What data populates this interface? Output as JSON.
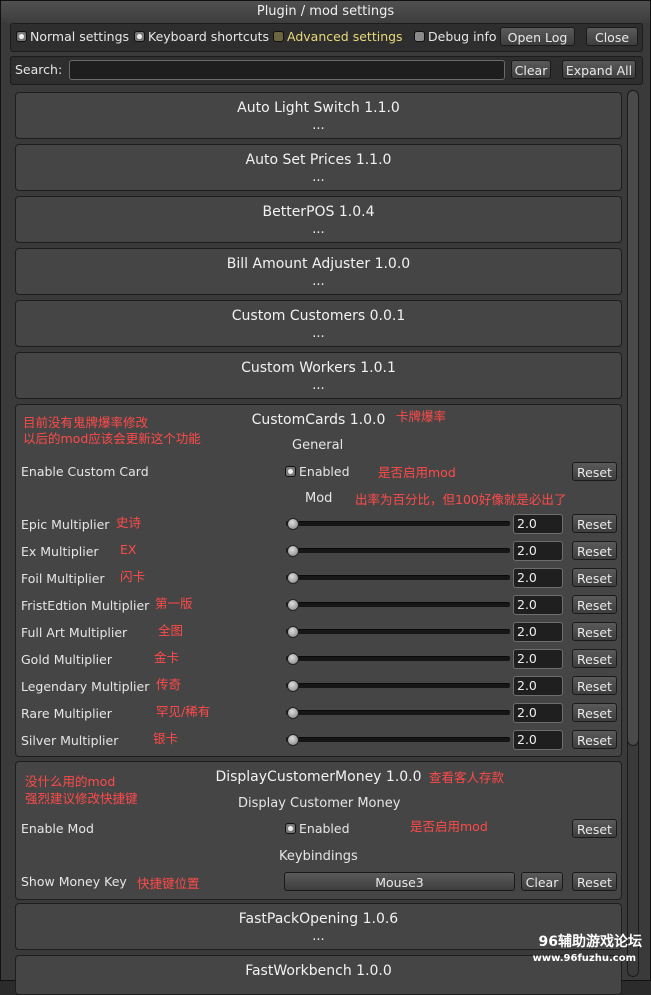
{
  "window": {
    "title": "Plugin / mod settings"
  },
  "toolbar": {
    "normal": "Normal settings",
    "keyboard": "Keyboard shortcuts",
    "advanced": "Advanced settings",
    "debug": "Debug info",
    "open_log": "Open Log",
    "close": "Close"
  },
  "search": {
    "label": "Search:",
    "value": "",
    "clear": "Clear",
    "expand": "Expand All"
  },
  "collapsed": [
    {
      "title": "Auto Light Switch 1.1.0",
      "dots": "..."
    },
    {
      "title": "Auto Set Prices 1.1.0",
      "dots": "..."
    },
    {
      "title": "BetterPOS 1.0.4",
      "dots": "..."
    },
    {
      "title": "Bill Amount Adjuster 1.0.0",
      "dots": "..."
    },
    {
      "title": "Custom Customers 0.0.1",
      "dots": "..."
    },
    {
      "title": "Custom Workers 1.0.1",
      "dots": "..."
    }
  ],
  "customcards": {
    "title": "CustomCards 1.0.0",
    "note_title": "卡牌爆率",
    "note_left_1": "目前没有鬼牌爆率修改",
    "note_left_2": "以后的mod应该会更新这个功能",
    "general": "General",
    "enable_label": "Enable Custom Card",
    "enabled": "Enabled",
    "enable_note": "是否启用mod",
    "reset": "Reset",
    "mod_section": "Mod",
    "mod_note": "出率为百分比，但100好像就是必出了",
    "rows": [
      {
        "label": "Epic Multiplier",
        "note": "史诗",
        "value": "2.0",
        "fraction": 0.02
      },
      {
        "label": "Ex Multiplier",
        "note": "EX",
        "value": "2.0",
        "fraction": 0.02
      },
      {
        "label": "Foil Multiplier",
        "note": "闪卡",
        "value": "2.0",
        "fraction": 0.02
      },
      {
        "label": "FristEdtion Multiplier",
        "note": "第一版",
        "value": "2.0",
        "fraction": 0.02
      },
      {
        "label": "Full Art  Multiplier",
        "note": "全图",
        "value": "2.0",
        "fraction": 0.02
      },
      {
        "label": "Gold Multiplier",
        "note": "金卡",
        "value": "2.0",
        "fraction": 0.02
      },
      {
        "label": "Legendary Multiplier",
        "note": "传奇",
        "value": "2.0",
        "fraction": 0.02
      },
      {
        "label": "Rare Multiplier",
        "note": "罕见/稀有",
        "value": "2.0",
        "fraction": 0.02
      },
      {
        "label": "Silver Multiplier",
        "note": "银卡",
        "value": "2.0",
        "fraction": 0.02
      }
    ]
  },
  "displaymoney": {
    "title": "DisplayCustomerMoney 1.0.0",
    "note_title": "查看客人存款",
    "note_left_1": "没什么用的mod",
    "note_left_2": "强烈建议修改快捷键",
    "section": "Display Customer Money",
    "enable_label": "Enable Mod",
    "enabled": "Enabled",
    "enable_note": "是否启用mod",
    "reset": "Reset",
    "keybindings": "Keybindings",
    "key_label": "Show Money Key",
    "key_note": "快捷键位置",
    "key_value": "Mouse3",
    "clear": "Clear"
  },
  "after": [
    {
      "title": "FastPackOpening 1.0.6",
      "dots": "..."
    },
    {
      "title": "FastWorkbench 1.0.0"
    }
  ],
  "watermark": {
    "line1": "96辅助游戏论坛",
    "line2": "www.96fuzhu.com"
  }
}
